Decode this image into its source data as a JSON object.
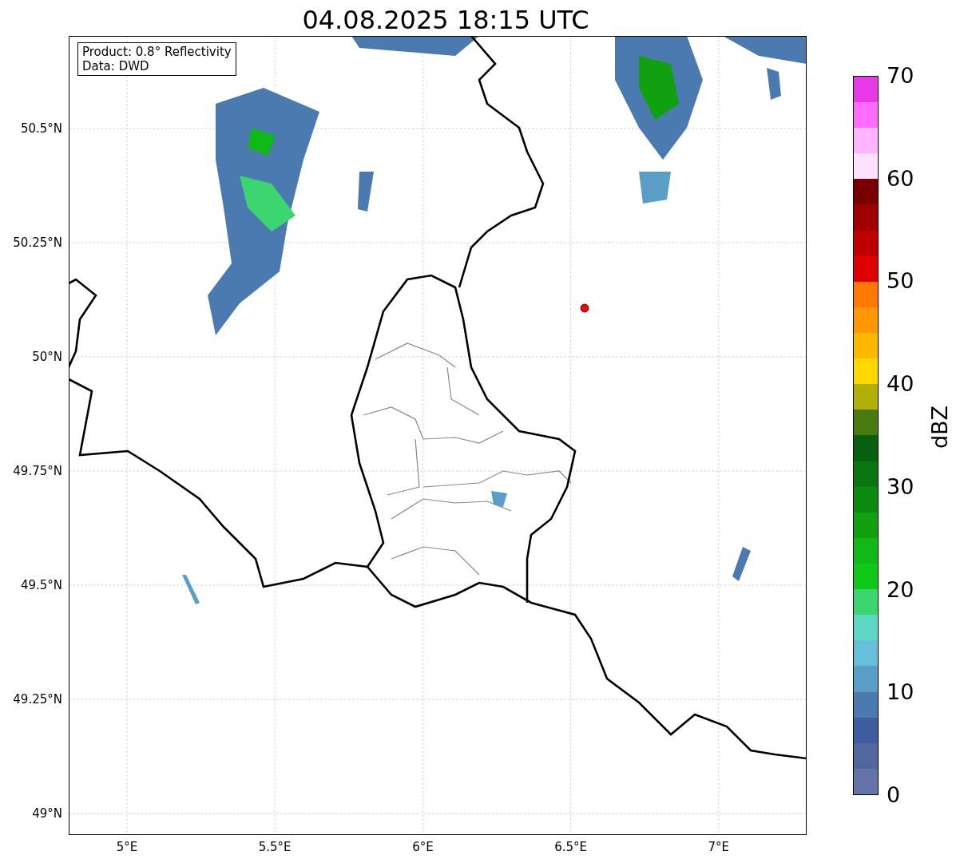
{
  "title": "04.08.2025 18:15 UTC",
  "info_box": [
    "Product: 0.8° Reflectivity",
    "Data: DWD"
  ],
  "y_ticks": [
    "50.5°N",
    "50.25°N",
    "50°N",
    "49.75°N",
    "49.5°N",
    "49.25°N",
    "49°N"
  ],
  "x_ticks": [
    "5°E",
    "5.5°E",
    "6°E",
    "6.5°E",
    "7°E"
  ],
  "colorbar": {
    "label": "dBZ",
    "ticks": [
      "70",
      "60",
      "50",
      "40",
      "30",
      "20",
      "10",
      "0"
    ],
    "bands": [
      {
        "color": "#6574a8"
      },
      {
        "color": "#5266a0"
      },
      {
        "color": "#405ca0"
      },
      {
        "color": "#4a7ab0"
      },
      {
        "color": "#5a9ec8"
      },
      {
        "color": "#66c0dc"
      },
      {
        "color": "#5cd8c4"
      },
      {
        "color": "#3cd670"
      },
      {
        "color": "#10c818"
      },
      {
        "color": "#10b818"
      },
      {
        "color": "#10a010"
      },
      {
        "color": "#0c8a10"
      },
      {
        "color": "#0a7610"
      },
      {
        "color": "#066010"
      },
      {
        "color": "#487a10"
      },
      {
        "color": "#b0b008"
      },
      {
        "color": "#ffd800"
      },
      {
        "color": "#ffb800"
      },
      {
        "color": "#ff9800"
      },
      {
        "color": "#ff7800"
      },
      {
        "color": "#e00000"
      },
      {
        "color": "#c00000"
      },
      {
        "color": "#a00000"
      },
      {
        "color": "#780000"
      },
      {
        "color": "#ffe0ff"
      },
      {
        "color": "#ffb4ff"
      },
      {
        "color": "#ff6cff"
      },
      {
        "color": "#e838e8"
      }
    ]
  }
}
